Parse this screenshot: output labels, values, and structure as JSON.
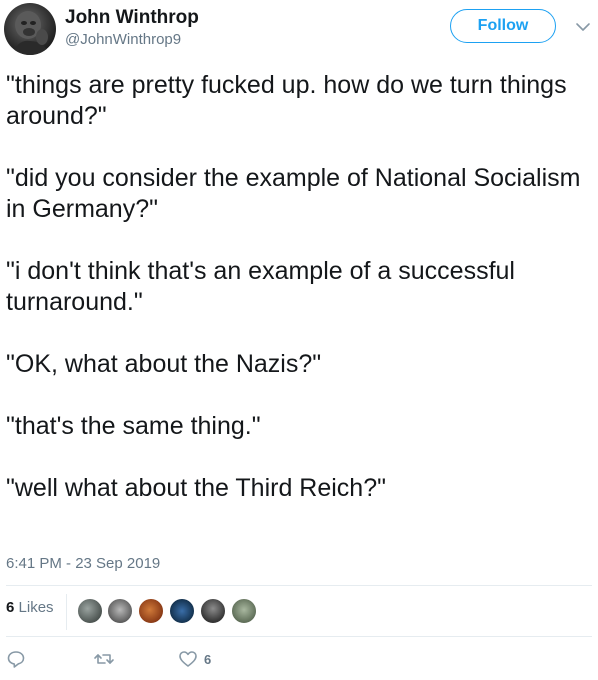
{
  "user": {
    "display_name": "John Winthrop",
    "handle": "@JohnWinthrop9",
    "follow_label": "Follow"
  },
  "tweet": {
    "paragraphs": [
      "\"things are pretty fucked up. how do we turn things around?\"",
      "\"did you consider the example of National Socialism in Germany?\"",
      "\"i don't think that's an example of a successful turnaround.\"",
      "\"OK, what about the Nazis?\"",
      "\"that's the same thing.\"",
      "\"well what about the Third Reich?\""
    ],
    "timestamp": "6:41 PM - 23 Sep 2019"
  },
  "stats": {
    "likes_number": "6",
    "likes_label": "Likes"
  },
  "actions": {
    "reply_icon": "reply-icon",
    "retweet_icon": "retweet-icon",
    "like_icon": "heart-icon",
    "like_count": "6"
  },
  "colors": {
    "accent": "#1da1f2",
    "muted": "#657786",
    "text": "#14171a",
    "divider": "#e6ecf0"
  }
}
